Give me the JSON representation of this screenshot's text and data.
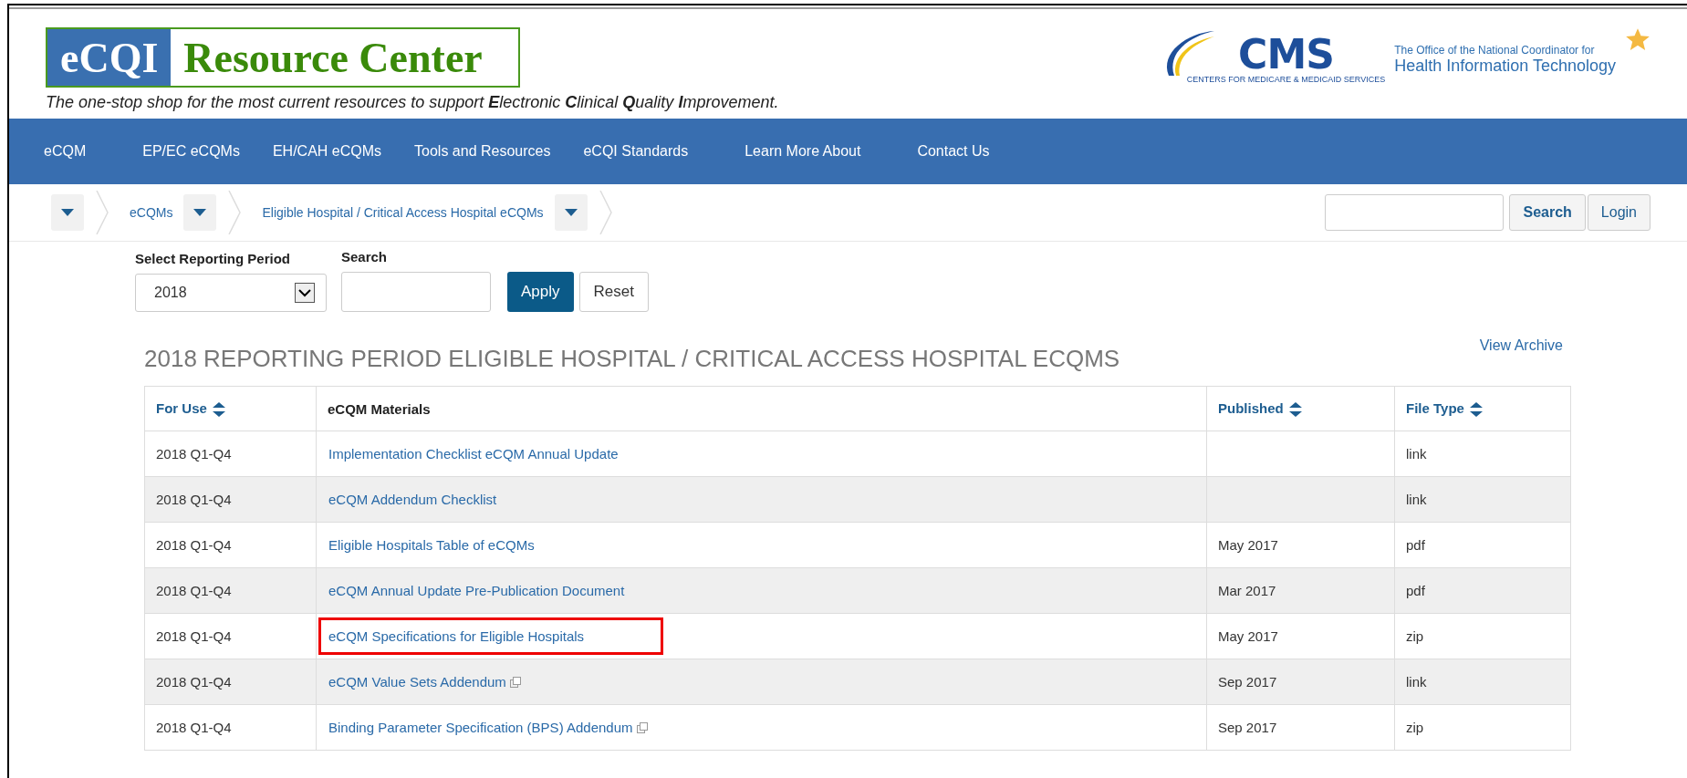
{
  "header": {
    "logo": {
      "badge": "eCQI",
      "name": "Resource Center"
    },
    "tagline": "The one-stop shop for the most current resources to support **E**lectronic **C**linical **Q**uality **I**mprovement.",
    "cms_logo": {
      "wordmark": "CMS",
      "subtitle": "CENTERS FOR MEDICARE & MEDICAID SERVICES"
    },
    "onc_logo": {
      "line_1": "The Office of the National Coordinator for",
      "line_2": "Health Information Technology"
    }
  },
  "nav": [
    "eCQM",
    "EP/EC eCQMs",
    "EH/CAH eCQMs",
    "Tools and Resources",
    "eCQI Standards",
    "Learn More About",
    "Contact Us"
  ],
  "breadcrumbs": [
    {
      "kind": "menu"
    },
    {
      "kind": "link",
      "label": "eCQMs"
    },
    {
      "kind": "link",
      "label": "Eligible Hospital / Critical Access Hospital eCQMs"
    }
  ],
  "site_search": {
    "button": "Search",
    "login": "Login"
  },
  "filters": {
    "period_label": "Select Reporting Period",
    "period_value": "2018",
    "search_label": "Search",
    "apply": "Apply",
    "reset": "Reset"
  },
  "heading": "2018 REPORTING PERIOD ELIGIBLE HOSPITAL / CRITICAL ACCESS HOSPITAL ECQMS",
  "view_archive": "View Archive",
  "table": {
    "columns": [
      {
        "label": "For Use",
        "sortable": true
      },
      {
        "label": "eCQM Materials",
        "sortable": false
      },
      {
        "label": "Published",
        "sortable": true
      },
      {
        "label": "File Type",
        "sortable": true
      }
    ],
    "rows": [
      {
        "for_use": "2018 Q1-Q4",
        "material": "Implementation Checklist eCQM Annual Update",
        "external": false,
        "highlighted": false,
        "published": "",
        "file_type": "link"
      },
      {
        "for_use": "2018 Q1-Q4",
        "material": "eCQM Addendum Checklist",
        "external": false,
        "highlighted": false,
        "published": "",
        "file_type": "link"
      },
      {
        "for_use": "2018 Q1-Q4",
        "material": "Eligible Hospitals Table of eCQMs",
        "external": false,
        "highlighted": false,
        "published": "May 2017",
        "file_type": "pdf"
      },
      {
        "for_use": "2018 Q1-Q4",
        "material": "eCQM Annual Update Pre-Publication Document",
        "external": false,
        "highlighted": false,
        "published": "Mar 2017",
        "file_type": "pdf"
      },
      {
        "for_use": "2018 Q1-Q4",
        "material": "eCQM Specifications for Eligible Hospitals",
        "external": false,
        "highlighted": true,
        "published": "May 2017",
        "file_type": "zip"
      },
      {
        "for_use": "2018 Q1-Q4",
        "material": "eCQM Value Sets Addendum",
        "external": true,
        "highlighted": false,
        "published": "Sep 2017",
        "file_type": "link"
      },
      {
        "for_use": "2018 Q1-Q4",
        "material": "Binding Parameter Specification (BPS) Addendum",
        "external": true,
        "highlighted": false,
        "published": "Sep 2017",
        "file_type": "zip"
      }
    ]
  }
}
